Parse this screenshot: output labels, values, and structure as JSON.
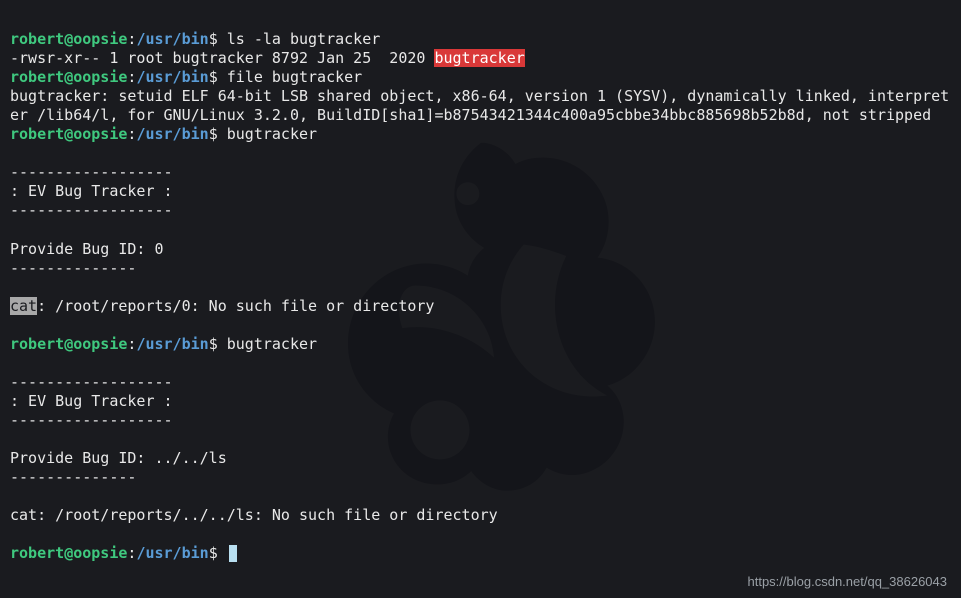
{
  "prompt": {
    "user": "robert",
    "host": "oopsie",
    "at": "@",
    "colon": ":",
    "path": "/usr/bin",
    "dollar": "$"
  },
  "lines": {
    "cmd1": " ls -la bugtracker",
    "out1a": "-rwsr-xr-- 1 root bugtracker 8792 Jan 25  2020 ",
    "out1b_hl": "bugtracker",
    "cmd2": " file bugtracker",
    "out2": "bugtracker: setuid ELF 64-bit LSB shared object, x86-64, version 1 (SYSV), dynamically linked, interpreter /lib64/l, for GNU/Linux 3.2.0, BuildID[sha1]=b87543421344c400a95cbbe34bbc885698b52b8d, not stripped",
    "cmd3": " bugtracker",
    "blank": "",
    "dash18": "------------------",
    "banner": ": EV Bug Tracker :",
    "provide0": "Provide Bug ID: 0",
    "dash14": "--------------",
    "cat_hl": "cat",
    "cat_rest": ": /root/reports/0: No such file or directory",
    "cmd4": " bugtracker",
    "provide_path": "Provide Bug ID: ../../ls",
    "cat_full": "cat: /root/reports/../../ls: No such file or directory",
    "cmd5": " "
  },
  "watermark": "https://blog.csdn.net/qq_38626043"
}
